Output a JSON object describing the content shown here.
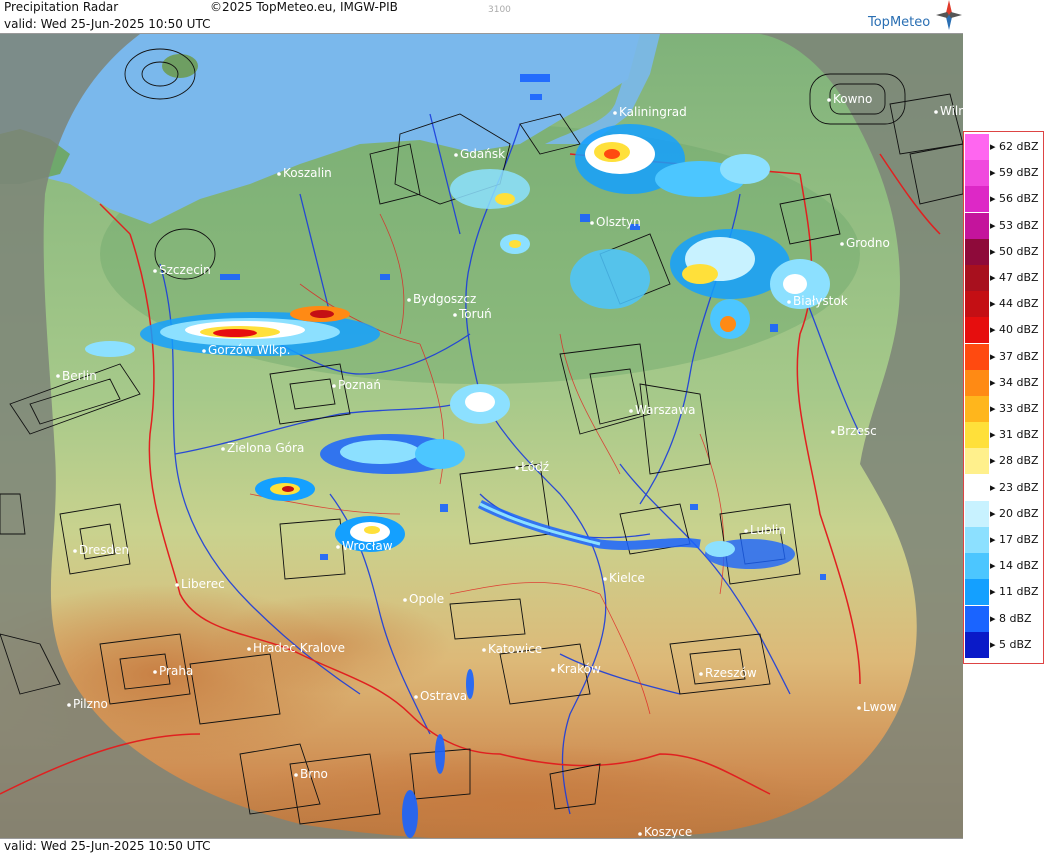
{
  "header": {
    "title": "Precipitation Radar",
    "valid": "valid:  Wed  25-Jun-2025 10:50 UTC",
    "copyright": "©2025 TopMeteo.eu, IMGW-PIB",
    "code": "3100",
    "brand": "TopMeteo"
  },
  "footer": {
    "valid": "valid:  Wed  25-Jun-2025 10:50 UTC"
  },
  "cities": [
    "Koszalin",
    "Gdańsk",
    "Kaliningrad",
    "Kowno",
    "Wilno",
    "Olsztyn",
    "Szczecin",
    "Grodno",
    "Białystok",
    "Bydgoszcz",
    "Toruń",
    "Gorzów Wlkp.",
    "Berlin",
    "Poznań",
    "Warszawa",
    "Brzesc",
    "Zielona Góra",
    "Łódź",
    "Lublin",
    "Dresden",
    "Wrocław",
    "Liberec",
    "Kielce",
    "Opole",
    "Hradec Kralove",
    "Katowice",
    "Praha",
    "Kraków",
    "Rzeszów",
    "Pilzno",
    "Ostrava",
    "Lwow",
    "Brno",
    "Koszyce"
  ],
  "legend": {
    "unit": "dBZ",
    "levels": [
      {
        "label": "62 dBZ",
        "color": "#ff66f0"
      },
      {
        "label": "59 dBZ",
        "color": "#f04ade"
      },
      {
        "label": "56 dBZ",
        "color": "#dd28c6"
      },
      {
        "label": "53 dBZ",
        "color": "#c4149c"
      },
      {
        "label": "50 dBZ",
        "color": "#8e0a3a"
      },
      {
        "label": "47 dBZ",
        "color": "#a8101e"
      },
      {
        "label": "44 dBZ",
        "color": "#c40f14"
      },
      {
        "label": "40 dBZ",
        "color": "#e60e0e"
      },
      {
        "label": "37 dBZ",
        "color": "#ff4a10"
      },
      {
        "label": "34 dBZ",
        "color": "#ff8a14"
      },
      {
        "label": "33 dBZ",
        "color": "#ffb61c"
      },
      {
        "label": "31 dBZ",
        "color": "#ffe03a"
      },
      {
        "label": "28 dBZ",
        "color": "#fff08c"
      },
      {
        "label": "23 dBZ",
        "color": "#ffffff"
      },
      {
        "label": "20 dBZ",
        "color": "#c8f2ff"
      },
      {
        "label": "17 dBZ",
        "color": "#8ce0ff"
      },
      {
        "label": "14 dBZ",
        "color": "#4cc6ff"
      },
      {
        "label": "11 dBZ",
        "color": "#14a0ff"
      },
      {
        "label": "8 dBZ",
        "color": "#1a64ff"
      },
      {
        "label": "5 dBZ",
        "color": "#0a1ac8"
      }
    ]
  },
  "colors": {
    "sea": "#7ab8ec",
    "lowland": "#8fbf86",
    "upland": "#d9cf8c",
    "mountain": "#cc8a4e",
    "coverage_outside": "#7d8478",
    "border": "#e02020",
    "river": "#1a3cdc",
    "airspace": "#111111"
  }
}
